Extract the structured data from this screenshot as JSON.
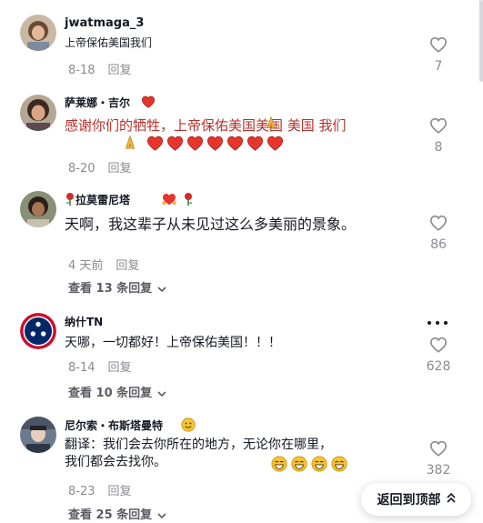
{
  "comments": [
    {
      "username": "jwatmaga_3",
      "text": "上帝保佑美国我们",
      "date": "8-18",
      "reply_label": "回复",
      "likes": "7"
    },
    {
      "username": "萨莱娜・吉尔",
      "text_line1": "感谢你们的牺牲，上帝保佑美国美国 美国 我们",
      "date": "8-20",
      "reply_label": "回复",
      "likes": "8",
      "emoji_names": [
        "heart",
        "pray",
        "pray",
        "heart x7"
      ]
    },
    {
      "username": "拉莫雷尼塔",
      "text": "天啊，我这辈子从未见过这么多美丽的景象。",
      "date": "4 天前",
      "reply_label": "回复",
      "likes": "86",
      "view_replies": "查看 13 条回复",
      "emoji_names": [
        "rose",
        "heart-hands",
        "rose"
      ]
    },
    {
      "username": "纳什TN",
      "text": "天哪，一切都好！上帝保佑美国！！！",
      "date": "8-14",
      "reply_label": "回复",
      "likes": "628",
      "view_replies": "查看 10 条回复"
    },
    {
      "username": "尼尔索・布斯塔曼特",
      "text_line1": "翻译：我们会去你所在的地方，无论你在哪里，",
      "text_line2": "我们都会去找你。",
      "date": "8-23",
      "reply_label": "回复",
      "likes": "382",
      "view_replies": "查看 25 条回复",
      "emoji_names": [
        "smile",
        "grin x4"
      ]
    }
  ],
  "back_to_top": "返回到顶部",
  "colors": {
    "text": "#161823",
    "meta": "#8a8b91",
    "comment2_text": "#b5312b",
    "heart": "#e8352c"
  }
}
